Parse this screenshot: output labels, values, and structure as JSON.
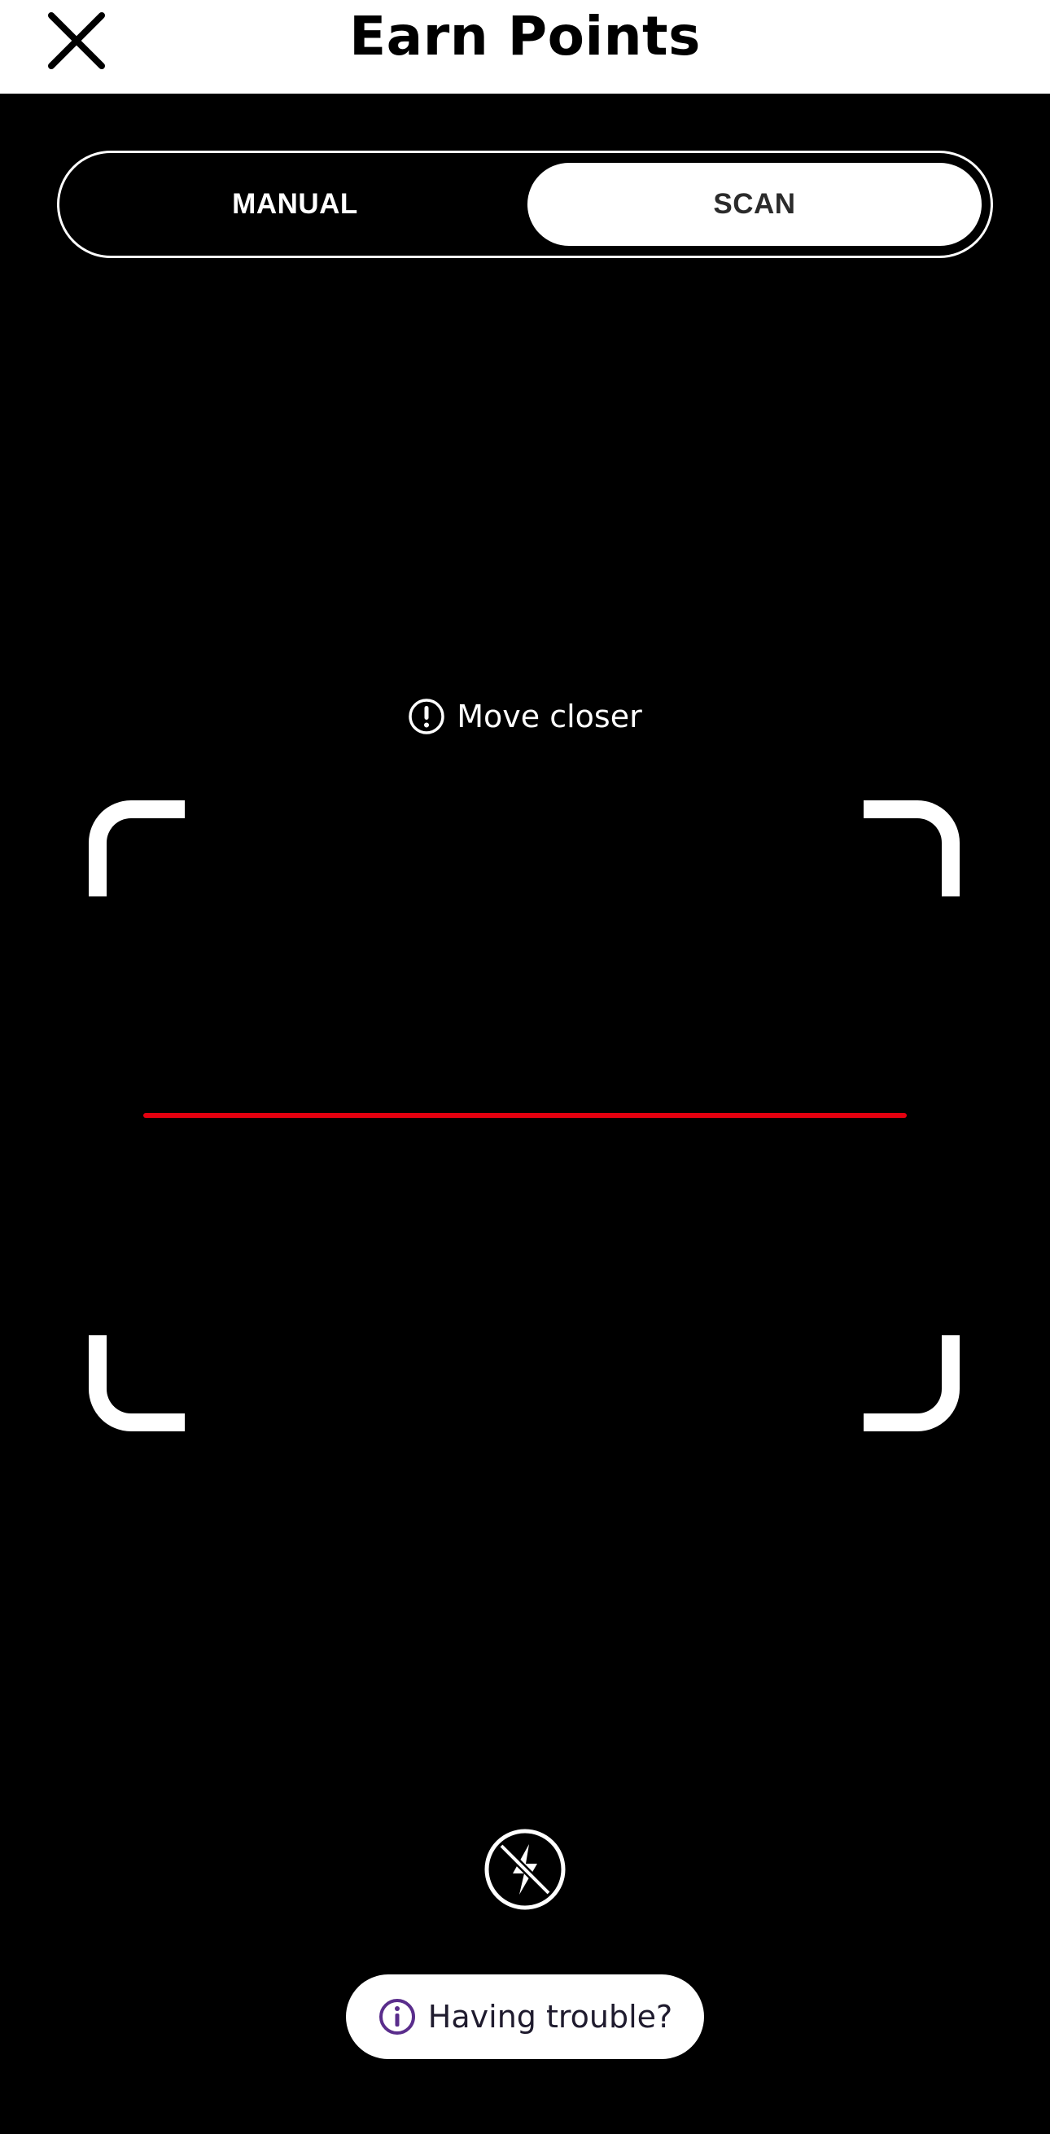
{
  "header": {
    "title": "Earn Points",
    "close_icon": "close-icon"
  },
  "mode_toggle": {
    "options": [
      {
        "label": "MANUAL",
        "selected": false
      },
      {
        "label": "SCAN",
        "selected": true
      }
    ]
  },
  "scanner": {
    "hint_text": "Move closer",
    "hint_icon": "exclamation-circle-icon",
    "scan_line_color": "#e3000f"
  },
  "flash": {
    "icon": "flash-off-icon"
  },
  "help": {
    "label": "Having trouble?",
    "icon": "info-circle-icon",
    "icon_color": "#5a2d8c"
  }
}
